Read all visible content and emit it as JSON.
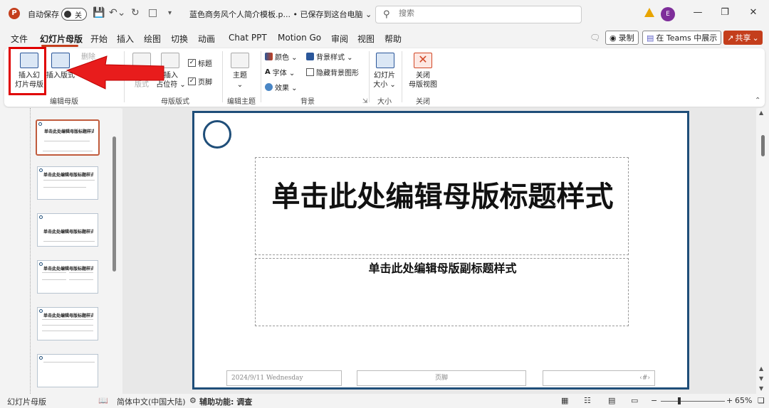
{
  "titlebar": {
    "app_logo": "P",
    "autosave_label": "自动保存",
    "autosave_state": "关",
    "doc_title": "蓝色商务风个人简介模板.p...  • 已保存到这台电脑 ⌄",
    "search_placeholder": "搜索",
    "avatar": "E"
  },
  "tabs": [
    "文件",
    "幻灯片母版",
    "开始",
    "插入",
    "绘图",
    "切换",
    "动画",
    "Chat PPT",
    "Motion Go",
    "审阅",
    "视图",
    "帮助"
  ],
  "actions": {
    "record": "录制",
    "teams": "在 Teams 中展示",
    "share": "共享"
  },
  "ribbon": {
    "insert_master": "插入幻\n灯片母版",
    "insert_layout": "插入版式",
    "delete": "删除",
    "master_layout": "母版\n版式",
    "insert_placeholder": "插入\n占位符 ⌄",
    "chk_title": "标题",
    "chk_footer": "页脚",
    "themes": "主题\n⌄",
    "colors": "颜色 ⌄",
    "fonts": "字体 ⌄",
    "effects": "效果 ⌄",
    "bg_styles": "背景样式 ⌄",
    "hide_bg": "隐藏背景图形",
    "slide_size": "幻灯片\n大小 ⌄",
    "close_master": "关闭\n母版视图",
    "groups": {
      "edit_master": "编辑母版",
      "master_layout": "母版版式",
      "edit_theme": "编辑主题",
      "background": "背景",
      "size": "大小",
      "close": "关闭"
    }
  },
  "thumbnails": [
    {
      "title": "单击此处编辑母版标题样式"
    },
    {
      "title": "单击此处编辑母版标题样式"
    },
    {
      "title": "单击此处编辑母版标题样式"
    },
    {
      "title": "单击此处编辑母版标题样式"
    },
    {
      "title": "单击此处编辑母版标题样式"
    },
    {
      "title": ""
    }
  ],
  "slide": {
    "title": "单击此处编辑母版标题样式",
    "subtitle": "单击此处编辑母版副标题样式",
    "date": "2024/9/11 Wednesday",
    "footer": "页脚",
    "number": "‹#›"
  },
  "statusbar": {
    "mode": "幻灯片母版",
    "language": "简体中文(中国大陆)",
    "accessibility": "辅助功能: 调查",
    "zoom": "65%"
  },
  "colors": {
    "accent": "#c43e1c",
    "slide_border": "#1f4e79",
    "highlight": "#e00000"
  }
}
